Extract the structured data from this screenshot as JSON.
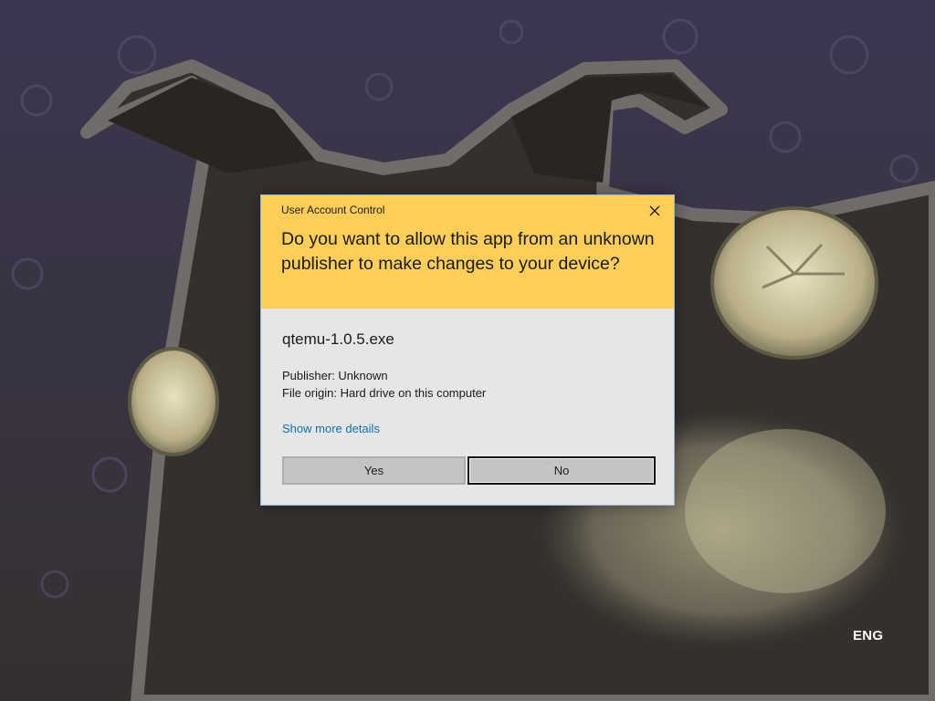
{
  "desktop": {
    "language": "ENG"
  },
  "uac": {
    "title": "User Account Control",
    "question": "Do you want to allow this app from an unknown publisher to make changes to your device?",
    "app_name": "qtemu-1.0.5.exe",
    "publisher": "Publisher: Unknown",
    "file_origin": "File origin: Hard drive on this computer",
    "details_link": "Show more details",
    "yes_label": "Yes",
    "no_label": "No",
    "close_icon": "close-icon"
  },
  "colors": {
    "header_background": "#fdcf59",
    "body_background": "#e6e6e6",
    "link": "#0b6fb8",
    "button_background": "#c4c4c4",
    "dialog_border": "#8fb3d6"
  }
}
